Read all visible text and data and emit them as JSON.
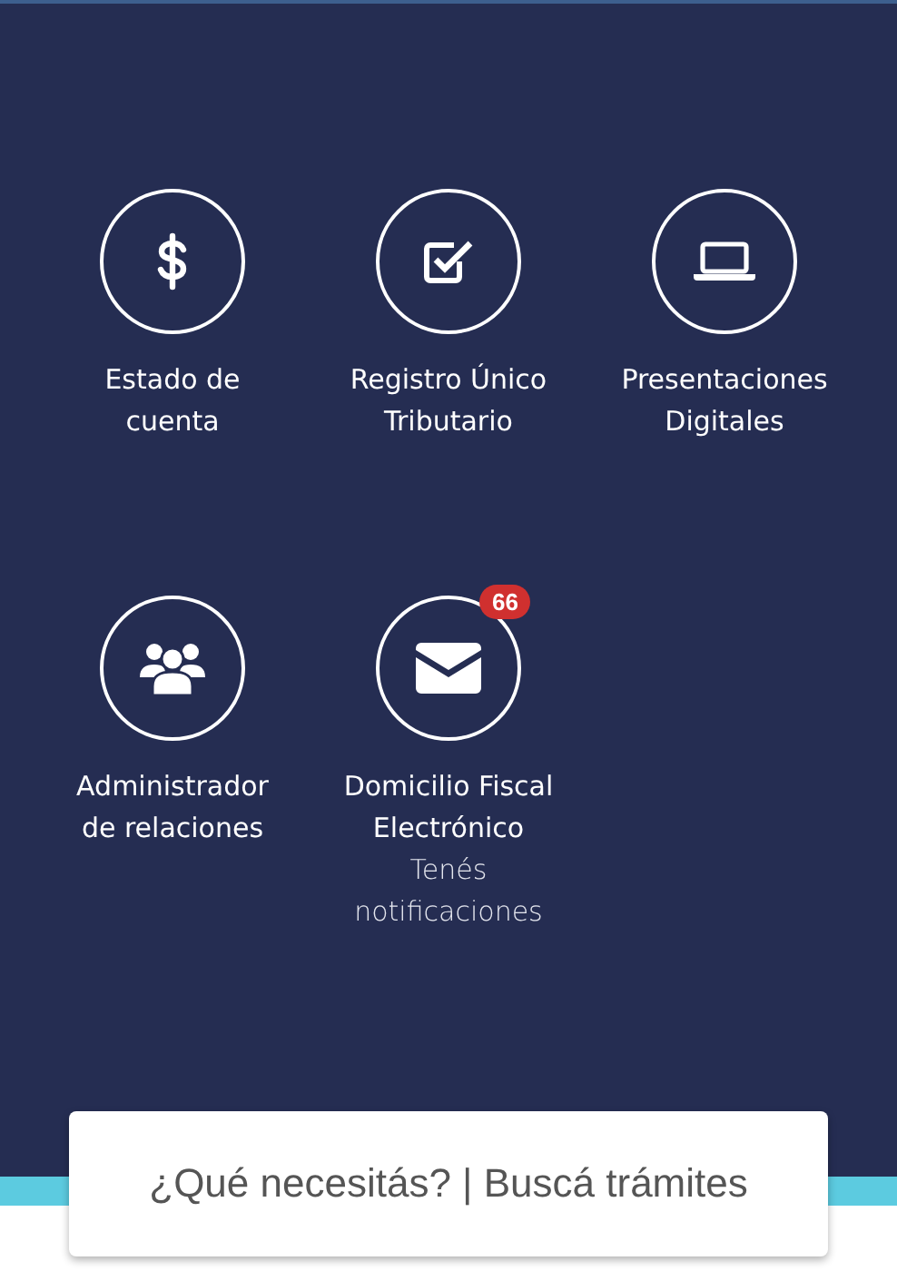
{
  "shortcuts": [
    {
      "kind": "dollar",
      "label_lines": [
        "Estado de",
        "cuenta"
      ]
    },
    {
      "kind": "check",
      "label_lines": [
        "Registro Único",
        "Tributario"
      ]
    },
    {
      "kind": "laptop",
      "label_lines": [
        "Presentaciones",
        "Digitales"
      ]
    },
    {
      "kind": "people",
      "label_lines": [
        "Administrador",
        "de relaciones"
      ]
    },
    {
      "kind": "mail",
      "label_lines": [
        "Domicilio Fiscal",
        "Electrónico"
      ],
      "badge": "66",
      "note_lines": [
        "Tenés",
        "notificaciones"
      ]
    }
  ],
  "search": {
    "placeholder": "¿Qué necesitás? | Buscá trámites"
  }
}
